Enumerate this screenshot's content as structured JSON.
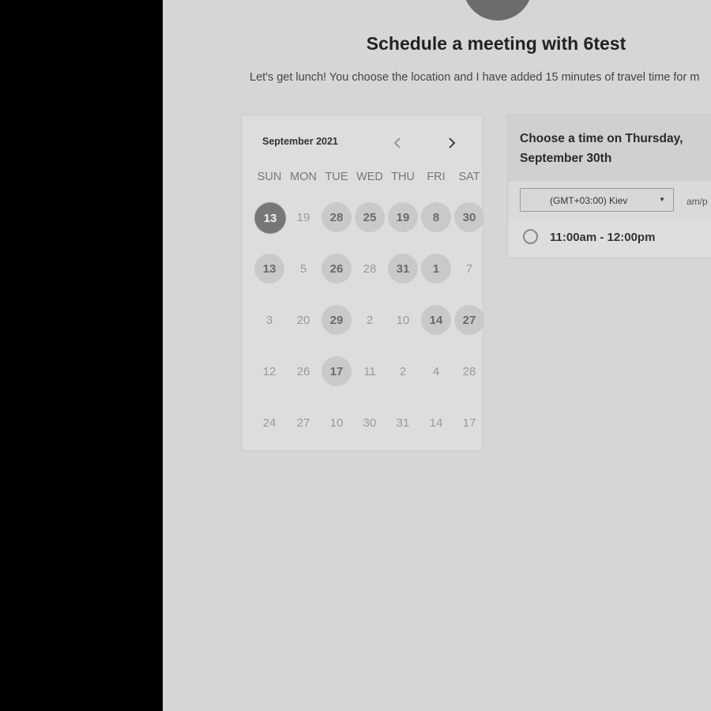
{
  "header": {
    "title": "Schedule a meeting with 6test",
    "subtitle": "Let's get lunch! You choose the location and I have added 15 minutes of travel time for m"
  },
  "calendar": {
    "month_label": "September 2021",
    "prev_icon": "chevron-left-icon",
    "next_icon": "chevron-right-icon",
    "weekdays": [
      "SUN",
      "MON",
      "TUE",
      "WED",
      "THU",
      "FRI",
      "SAT"
    ],
    "weeks": [
      [
        {
          "d": "13",
          "s": "selected"
        },
        {
          "d": "19",
          "s": ""
        },
        {
          "d": "28",
          "s": "available"
        },
        {
          "d": "25",
          "s": "available"
        },
        {
          "d": "19",
          "s": "available"
        },
        {
          "d": "8",
          "s": "available"
        },
        {
          "d": "30",
          "s": "available"
        }
      ],
      [
        {
          "d": "13",
          "s": "available"
        },
        {
          "d": "5",
          "s": ""
        },
        {
          "d": "26",
          "s": "available"
        },
        {
          "d": "28",
          "s": ""
        },
        {
          "d": "31",
          "s": "available"
        },
        {
          "d": "1",
          "s": "available"
        },
        {
          "d": "7",
          "s": ""
        }
      ],
      [
        {
          "d": "3",
          "s": ""
        },
        {
          "d": "20",
          "s": ""
        },
        {
          "d": "29",
          "s": "available"
        },
        {
          "d": "2",
          "s": ""
        },
        {
          "d": "10",
          "s": ""
        },
        {
          "d": "14",
          "s": "available"
        },
        {
          "d": "27",
          "s": "available"
        }
      ],
      [
        {
          "d": "12",
          "s": ""
        },
        {
          "d": "26",
          "s": ""
        },
        {
          "d": "17",
          "s": "available"
        },
        {
          "d": "11",
          "s": ""
        },
        {
          "d": "2",
          "s": ""
        },
        {
          "d": "4",
          "s": ""
        },
        {
          "d": "28",
          "s": ""
        }
      ],
      [
        {
          "d": "24",
          "s": ""
        },
        {
          "d": "27",
          "s": ""
        },
        {
          "d": "10",
          "s": ""
        },
        {
          "d": "30",
          "s": ""
        },
        {
          "d": "31",
          "s": ""
        },
        {
          "d": "14",
          "s": ""
        },
        {
          "d": "17",
          "s": ""
        }
      ]
    ]
  },
  "times": {
    "heading": "Choose a time on Thursday, September 30th",
    "timezone": "(GMT+03:00) Kiev",
    "ampm_toggle": "am/p",
    "slots": [
      {
        "label": "11:00am - 12:00pm",
        "selected": false
      }
    ]
  }
}
